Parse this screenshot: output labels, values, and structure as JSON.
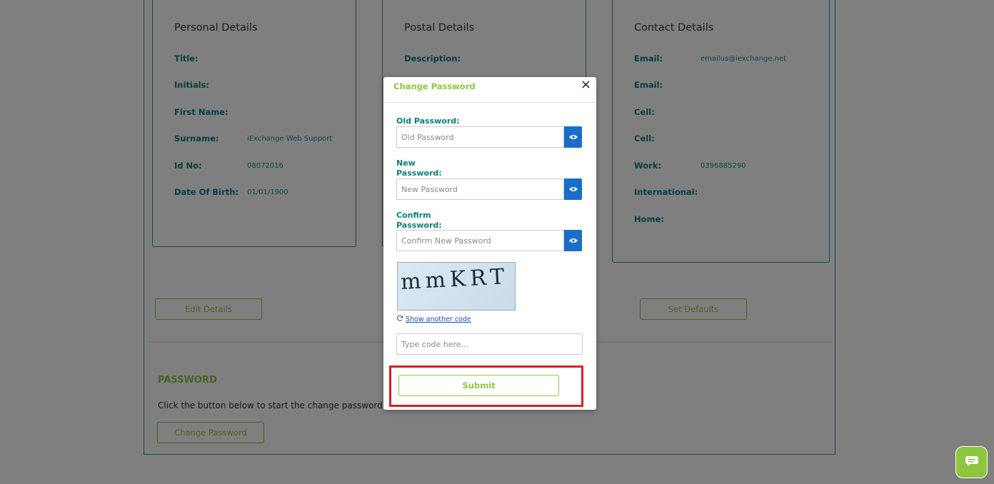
{
  "personal": {
    "title": "Personal Details",
    "fields": [
      {
        "label": "Title:",
        "value": ""
      },
      {
        "label": "Initials:",
        "value": ""
      },
      {
        "label": "First Name:",
        "value": ""
      },
      {
        "label": "Surname:",
        "value": "iExchange Web Support"
      },
      {
        "label": "Id No:",
        "value": "08072016"
      },
      {
        "label": "Date Of Birth:",
        "value": "01/01/1900"
      }
    ]
  },
  "postal": {
    "title": "Postal Details",
    "fields": [
      {
        "label": "Description:",
        "value": ""
      }
    ]
  },
  "contact": {
    "title": "Contact Details",
    "fields": [
      {
        "label": "Email:",
        "value": "emailus@iexchange.net"
      },
      {
        "label": "Email:",
        "value": ""
      },
      {
        "label": "Cell:",
        "value": ""
      },
      {
        "label": "Cell:",
        "value": ""
      },
      {
        "label": "Work:",
        "value": "0396885290"
      },
      {
        "label": "International:",
        "value": ""
      },
      {
        "label": "Home:",
        "value": ""
      }
    ]
  },
  "buttons": {
    "edit_details": "Edit Details",
    "set_defaults": "Set Defaults",
    "change_password": "Change Password"
  },
  "password_section": {
    "heading": "PASSWORD",
    "description": "Click the button below to start the change password proce"
  },
  "modal": {
    "title": "Change Password",
    "close": "×",
    "old_password_label": "Old Password:",
    "old_password_placeholder": "Old Password",
    "new_password_label_1": "New",
    "new_password_label_2": "Password:",
    "new_password_placeholder": "New Password",
    "confirm_password_label_1": "Confirm",
    "confirm_password_label_2": "Password:",
    "confirm_password_placeholder": "Confirm New Password",
    "captcha_text": "mmKRT",
    "show_another_code": "Show another code",
    "code_placeholder": "Type code here...",
    "submit": "Submit"
  },
  "icons": {
    "eye": "eye-icon",
    "refresh": "refresh-icon",
    "chat": "chat-icon"
  },
  "colors": {
    "teal": "#0f7d7d",
    "green": "#8dc63f",
    "blue": "#1a6ec8",
    "highlight_red": "#d8202a"
  }
}
